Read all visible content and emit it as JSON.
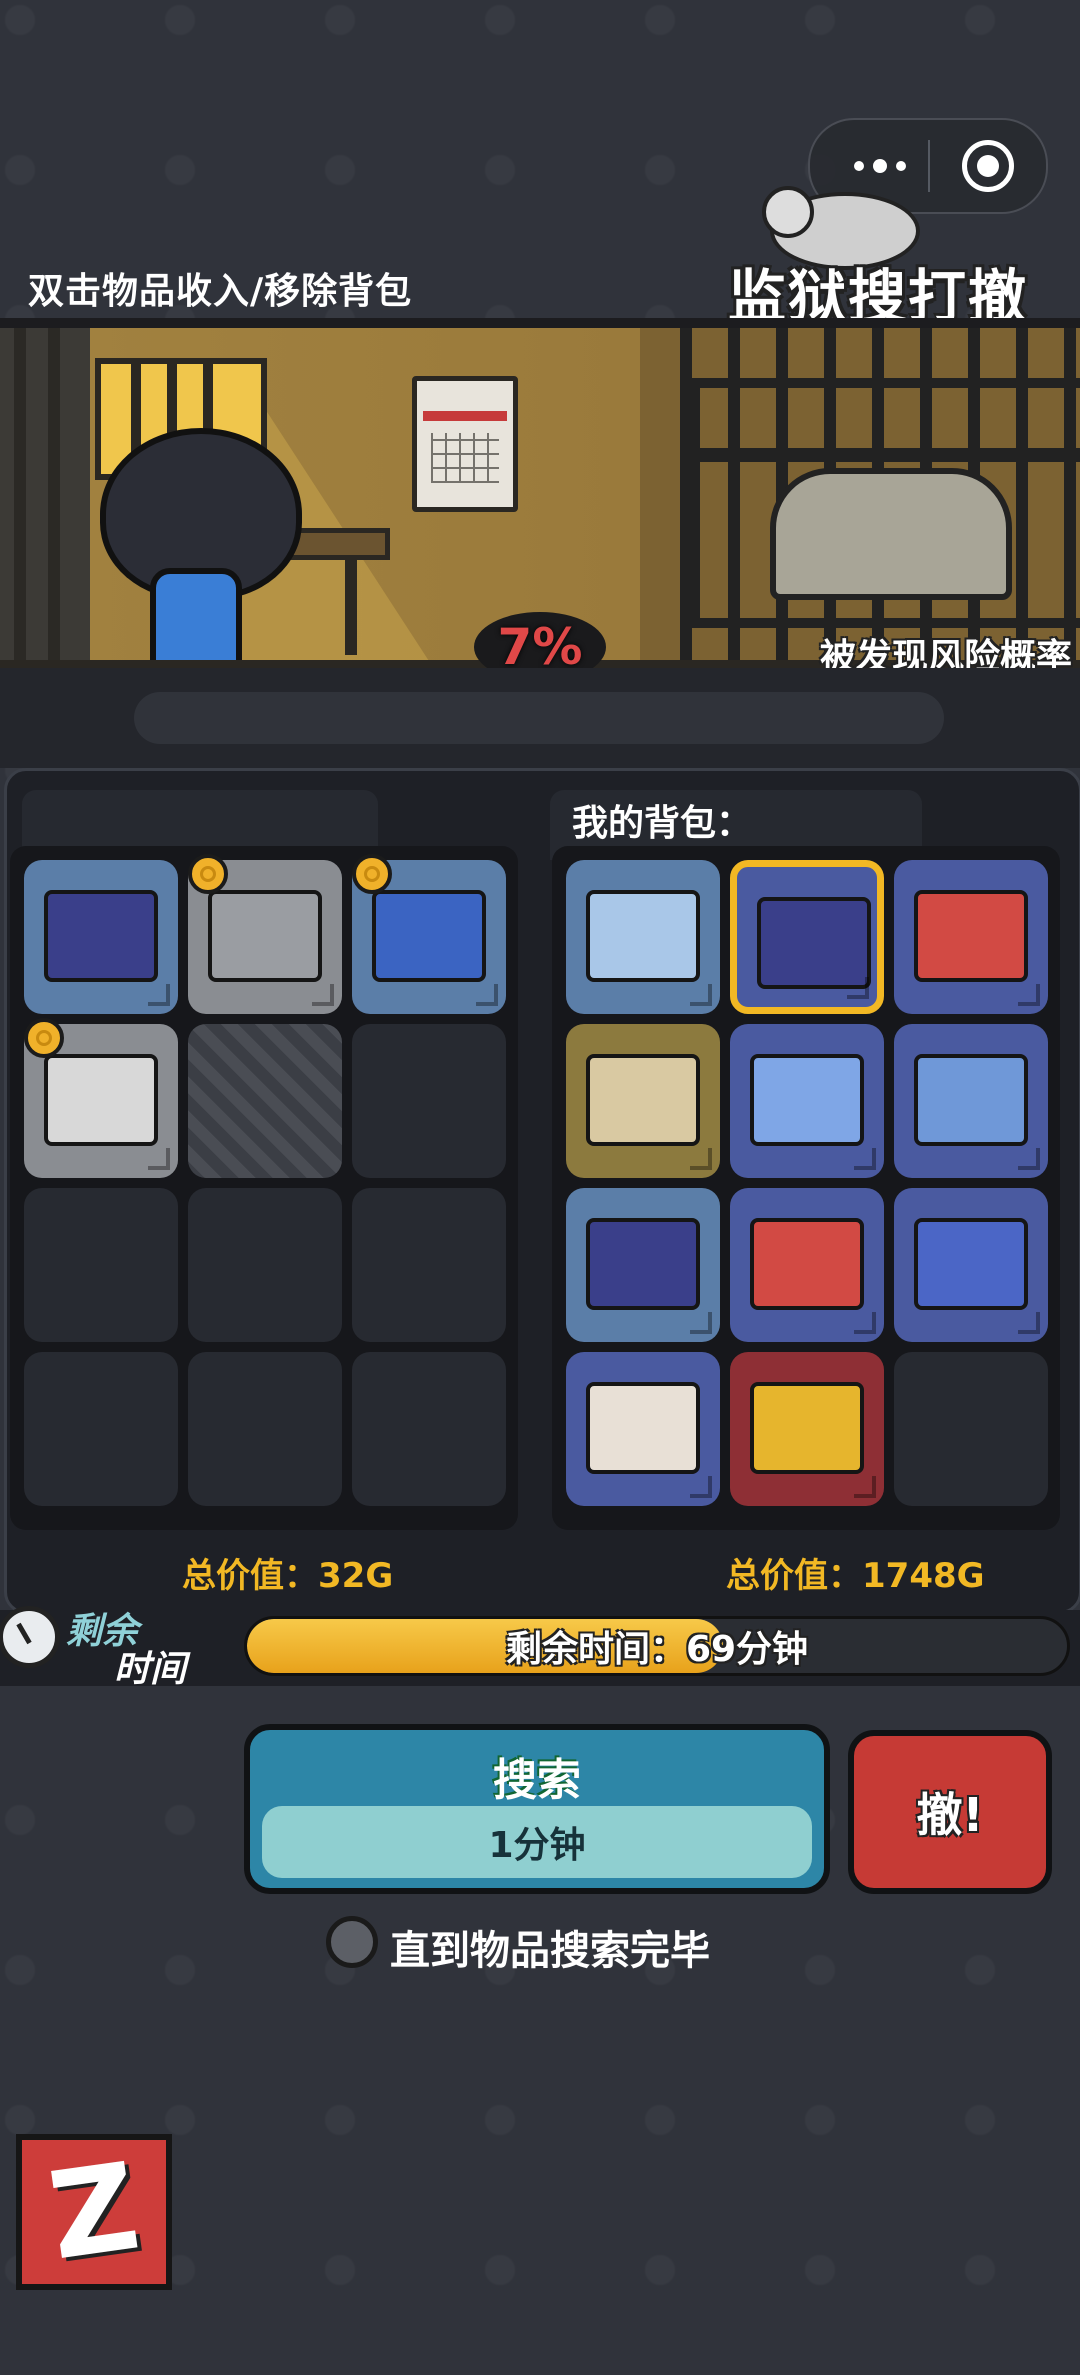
{
  "header": {
    "instruction": "双击物品收入/移除背包",
    "game_title": "监狱搜打撤"
  },
  "capsule": {
    "menu_icon": "more-dots-icon",
    "close_icon": "target-icon"
  },
  "scene": {
    "risk_percent": "7%",
    "risk_label": "被发现风险概率",
    "progress_fraction": 0
  },
  "container": {
    "total_value": "总价值：32G",
    "items": [
      {
        "icon": "food-pack-icon",
        "color": "#5b7ea8",
        "art": "#3a3f8a",
        "coin": false
      },
      {
        "icon": "metal-scrap-icon",
        "color": "#8a8d92",
        "art": "#9a9da2",
        "coin": true
      },
      {
        "icon": "lightning-poster-icon",
        "color": "#5b7ea8",
        "art": "#3b64c2",
        "coin": true
      },
      {
        "icon": "comic-book-icon",
        "color": "#8a8d92",
        "art": "#d8d8d8",
        "coin": true
      },
      {
        "icon": "locked-slot-icon",
        "color": "locked",
        "art": "",
        "coin": false
      },
      {
        "icon": "empty-slot",
        "color": "empty",
        "art": "",
        "coin": false
      },
      {
        "icon": "empty-slot",
        "color": "empty",
        "art": "",
        "coin": false
      },
      {
        "icon": "empty-slot",
        "color": "empty",
        "art": "",
        "coin": false
      },
      {
        "icon": "empty-slot",
        "color": "empty",
        "art": "",
        "coin": false
      },
      {
        "icon": "empty-slot",
        "color": "empty",
        "art": "",
        "coin": false
      },
      {
        "icon": "empty-slot",
        "color": "empty",
        "art": "",
        "coin": false
      },
      {
        "icon": "empty-slot",
        "color": "empty",
        "art": "",
        "coin": false
      }
    ]
  },
  "backpack": {
    "title": "我的背包：",
    "total_value": "总价值：1748G",
    "items": [
      {
        "icon": "blue-pills-icon",
        "color": "#5b7ea8",
        "art": "#a9c7e8",
        "selected": false
      },
      {
        "icon": "burger-pack-icon",
        "color": "#4a5aa0",
        "art": "#3a3f8a",
        "selected": true
      },
      {
        "icon": "first-aid-kit-icon",
        "color": "#4a5aa0",
        "art": "#d24a44",
        "selected": false
      },
      {
        "icon": "film-reel-icon",
        "color": "#8c7a3e",
        "art": "#d9c9a2",
        "selected": false
      },
      {
        "icon": "toy-ticket-icon",
        "color": "#4a5aa0",
        "art": "#7fa6e6",
        "selected": false
      },
      {
        "icon": "blue-bandage-icon",
        "color": "#4a5aa0",
        "art": "#6f98d8",
        "selected": false
      },
      {
        "icon": "food-pack-icon",
        "color": "#5b7ea8",
        "art": "#3a3f8a",
        "selected": false
      },
      {
        "icon": "first-aid-kit-icon",
        "color": "#4a5aa0",
        "art": "#d24a44",
        "selected": false
      },
      {
        "icon": "pill-blister-icon",
        "color": "#4a5aa0",
        "art": "#4b66c6",
        "selected": false
      },
      {
        "icon": "hot-sauce-bottle-icon",
        "color": "#4a5aa0",
        "art": "#e8e0d6",
        "selected": false
      },
      {
        "icon": "gold-bar-card-icon",
        "color": "#8e2f35",
        "art": "#e6b52d",
        "selected": false
      },
      {
        "icon": "empty-slot",
        "color": "empty",
        "art": "",
        "selected": false
      }
    ]
  },
  "timer": {
    "label_top": "剩余",
    "label_bottom": "时间",
    "text": "剩余时间：69分钟",
    "fill_fraction": 0.58
  },
  "actions": {
    "search_label": "搜索",
    "search_duration": "1分钟",
    "escape_label": "撤!",
    "until_done_label": "直到物品搜索完毕"
  },
  "colors": {
    "accent": "#f2b824",
    "search": "#2d86a7",
    "escape": "#c63a35",
    "risk": "#e04848"
  }
}
